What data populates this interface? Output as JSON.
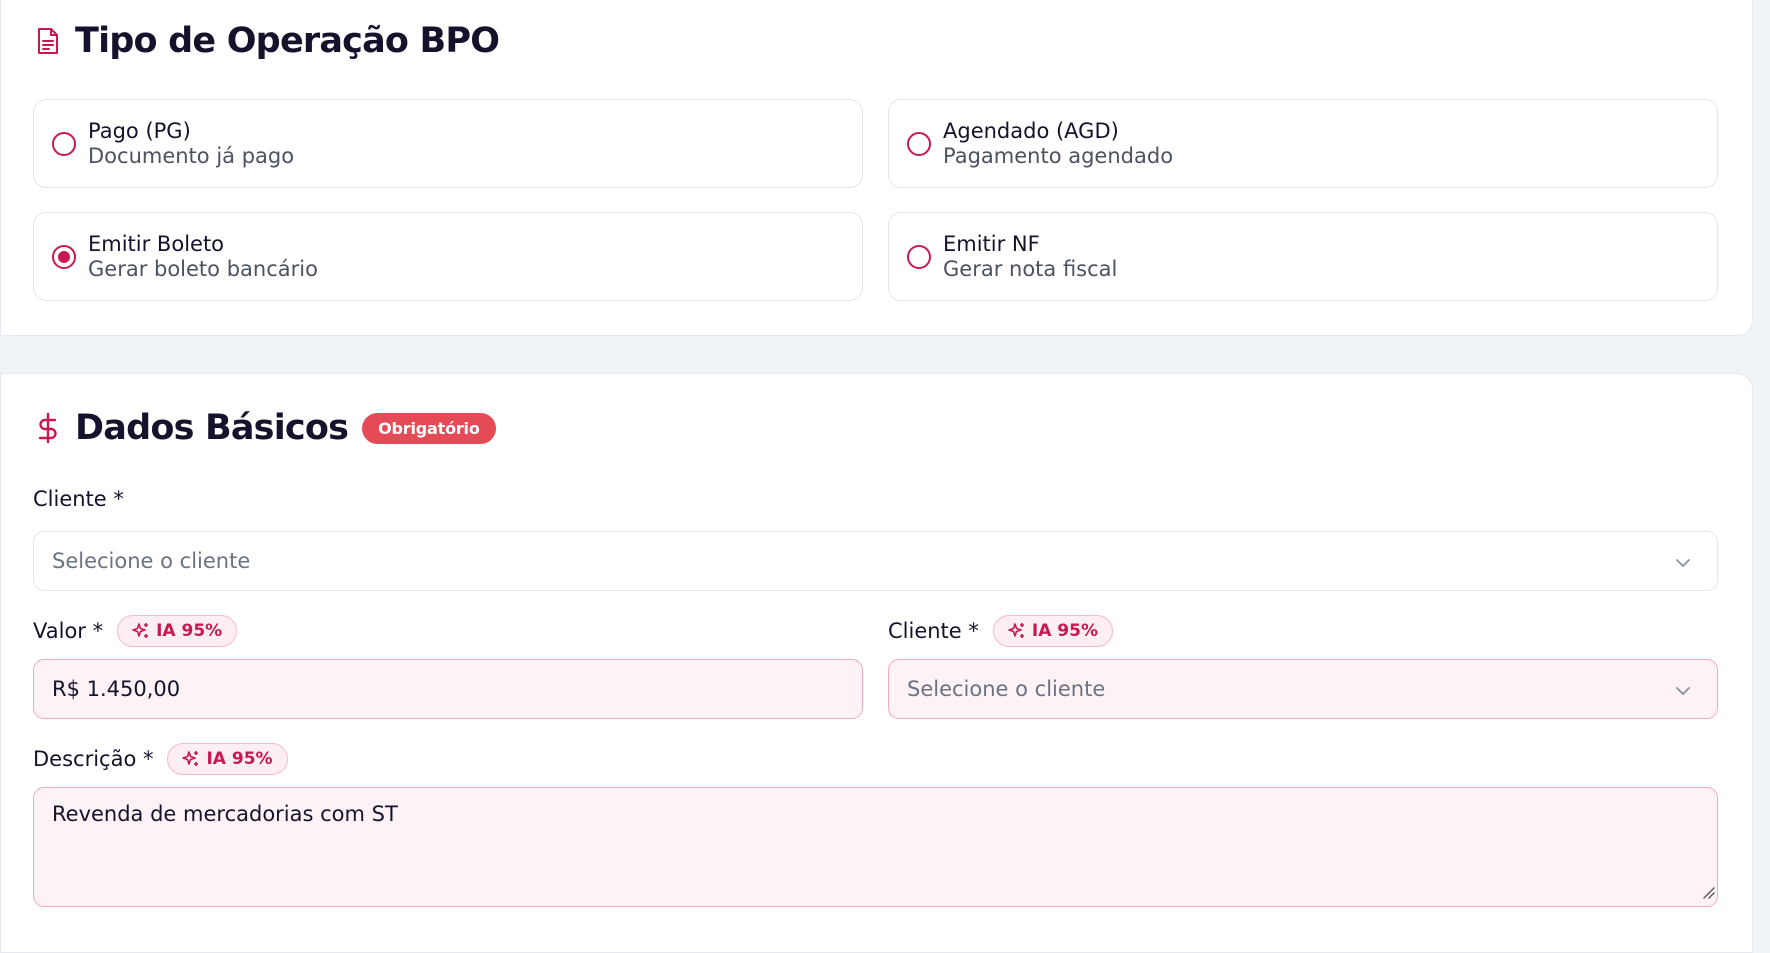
{
  "operation": {
    "title": "Tipo de Operação BPO",
    "options": [
      {
        "title": "Pago (PG)",
        "subtitle": "Documento já pago",
        "selected": false
      },
      {
        "title": "Agendado (AGD)",
        "subtitle": "Pagamento agendado",
        "selected": false
      },
      {
        "title": "Emitir Boleto",
        "subtitle": "Gerar boleto bancário",
        "selected": true
      },
      {
        "title": "Emitir NF",
        "subtitle": "Gerar nota fiscal",
        "selected": false
      }
    ]
  },
  "basic": {
    "title": "Dados Básicos",
    "required_badge": "Obrigatório",
    "cliente_label": "Cliente *",
    "cliente_placeholder": "Selecione o cliente",
    "valor_label": "Valor *",
    "valor_ai": "IA 95%",
    "valor_value": "R$ 1.450,00",
    "cliente2_label": "Cliente *",
    "cliente2_ai": "IA 95%",
    "cliente2_placeholder": "Selecione o cliente",
    "descricao_label": "Descrição *",
    "descricao_ai": "IA 95%",
    "descricao_value": "Revenda de mercadorias com ST"
  },
  "colors": {
    "accent": "#c8184f",
    "required": "#e54b56",
    "ai_fill": "#fdf2f5"
  },
  "icons": {
    "operation": "document-icon",
    "basic": "dollar-icon",
    "ai": "sparkles-icon",
    "select": "chevron-down-icon"
  }
}
